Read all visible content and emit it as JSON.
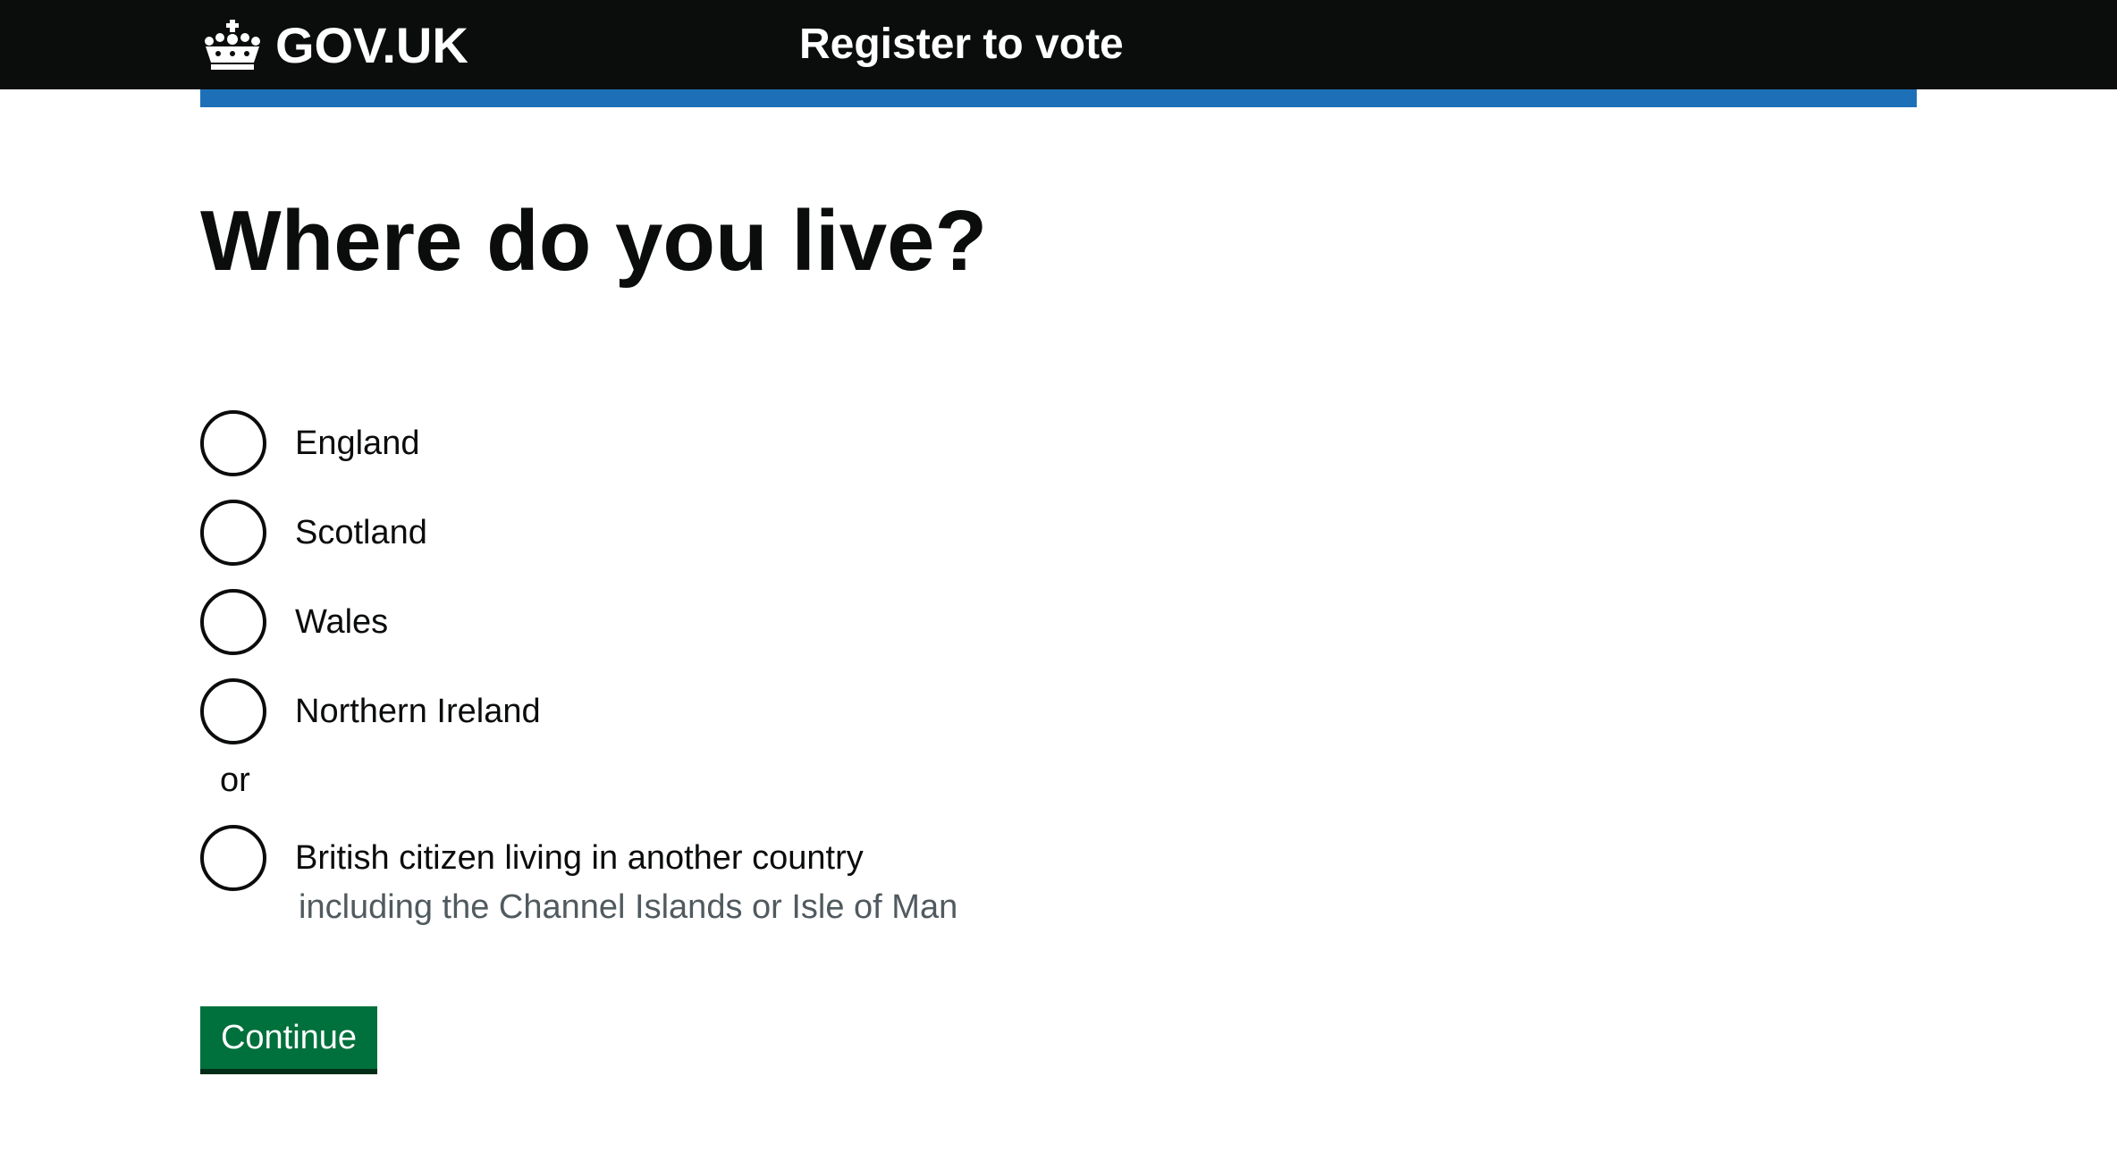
{
  "header": {
    "logo_text": "GOV.UK",
    "service_name": "Register to vote",
    "background_color": "#0b0c0c",
    "accent_bar_color": "#1d70b8"
  },
  "question": {
    "heading": "Where do you live?"
  },
  "options": [
    {
      "label": "England"
    },
    {
      "label": "Scotland"
    },
    {
      "label": "Wales"
    },
    {
      "label": "Northern Ireland"
    },
    {
      "label": "British citizen living in another country",
      "hint": "including the Channel Islands or Isle of Man"
    }
  ],
  "divider_text": "or",
  "continue_button": {
    "label": "Continue",
    "color": "#00703c"
  }
}
